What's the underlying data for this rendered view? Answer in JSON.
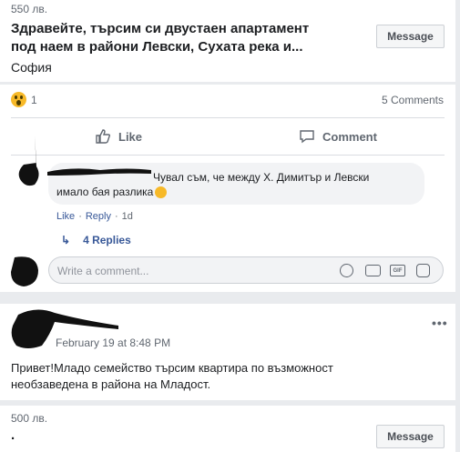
{
  "listing1": {
    "price": "550 лв.",
    "title_line1": "Здравейте, търсим си двустаен апартамент",
    "title_line2": "под наем в райони Левски, Сухата река и...",
    "location": "София",
    "message_label": "Message"
  },
  "reactions": {
    "count": "1",
    "comments_count": "5 Comments"
  },
  "actions": {
    "like": "Like",
    "comment": "Comment"
  },
  "comment": {
    "text_line1": "Чувал съм, че между Х. Димитър и Левски",
    "text_line2": "имало бая разлика",
    "like": "Like",
    "dot1": "·",
    "reply": "Reply",
    "dot2": "·",
    "time": "1d",
    "replies": "4 Replies"
  },
  "compose": {
    "placeholder": "Write a comment..."
  },
  "post2": {
    "date": "February 19 at 8:48 PM",
    "text_line1": "Привет!Младо семейство търсим квартира по възможност",
    "text_line2": "необзаведена в района на Младост."
  },
  "listing2": {
    "price": "500 лв.",
    "title": ".",
    "message_label": "Message"
  },
  "colors": {
    "background": "#e9ebee",
    "link": "#385898",
    "muted": "#606770",
    "wow_yellow": "#f7b928"
  }
}
